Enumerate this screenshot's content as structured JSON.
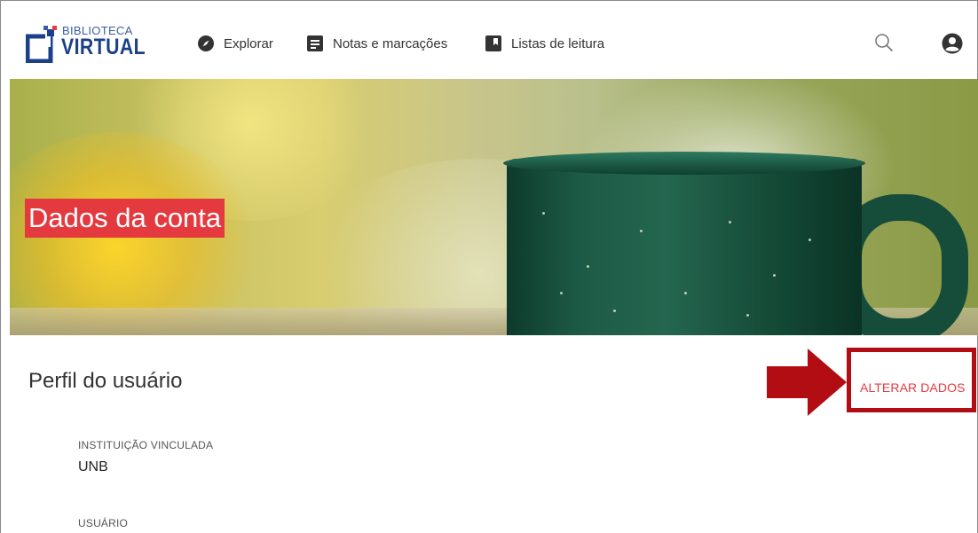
{
  "header": {
    "logo_small": "BIBLIOTECA",
    "logo_big": "VIRTUAL",
    "nav": [
      {
        "label": "Explorar",
        "icon": "compass-icon"
      },
      {
        "label": "Notas e marcações",
        "icon": "notes-icon"
      },
      {
        "label": "Listas de leitura",
        "icon": "bookmark-icon"
      }
    ],
    "icons": [
      "search-icon",
      "account-icon"
    ]
  },
  "hero": {
    "title": "Dados da conta"
  },
  "profile": {
    "title": "Perfil do usuário",
    "edit_label": "ALTERAR DADOS",
    "fields": [
      {
        "label": "INSTITUIÇÃO VINCULADA",
        "value": "UNB"
      },
      {
        "label": "USUÁRIO",
        "value": ""
      }
    ]
  },
  "colors": {
    "accent": "#e43a3f",
    "brand_blue": "#1b3f8a",
    "annotation_red": "#b10d13"
  }
}
